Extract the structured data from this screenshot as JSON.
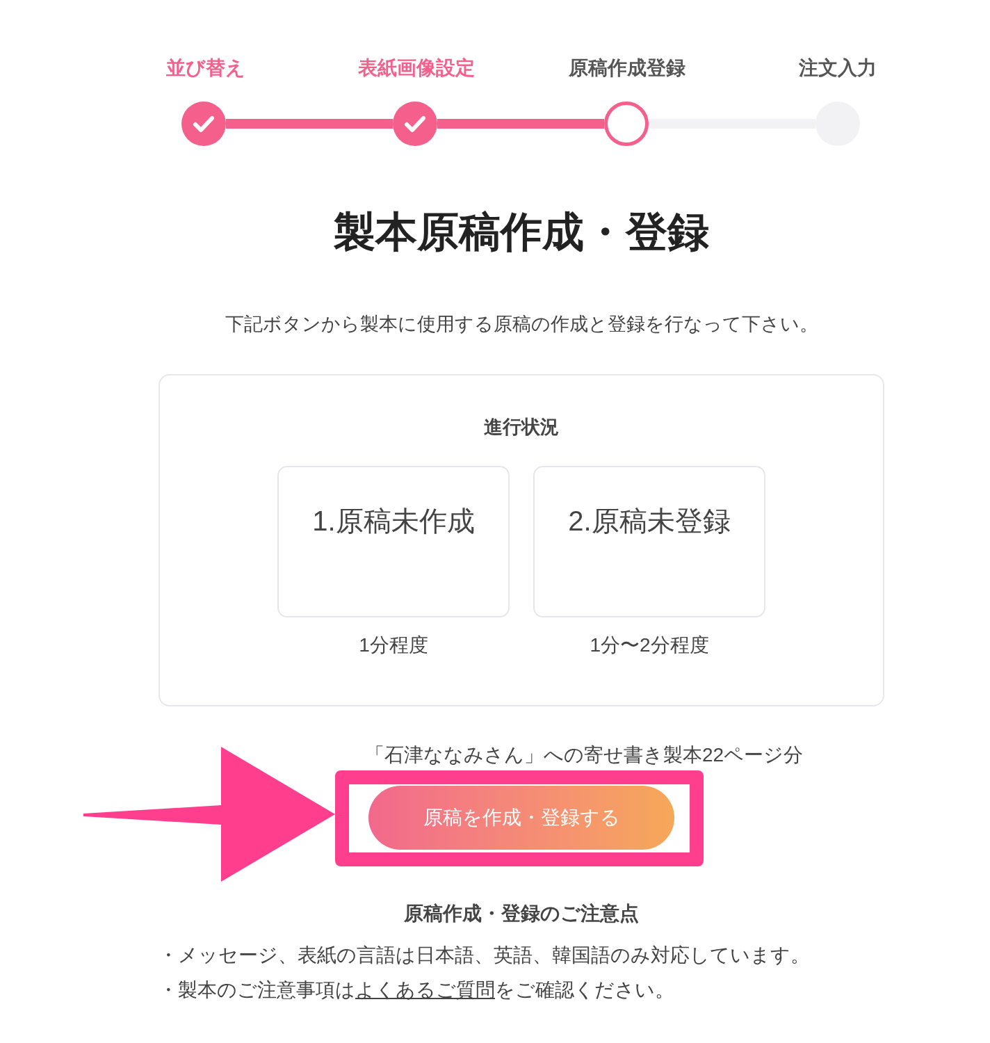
{
  "steps": [
    {
      "label": "並び替え",
      "completed": true,
      "current": false
    },
    {
      "label": "表紙画像設定",
      "completed": true,
      "current": false
    },
    {
      "label": "原稿作成登録",
      "completed": false,
      "current": true
    },
    {
      "label": "注文入力",
      "completed": false,
      "current": false
    }
  ],
  "title": "製本原稿作成・登録",
  "description": "下記ボタンから製本に使用する原稿の作成と登録を行なって下さい。",
  "progress": {
    "title": "進行状況",
    "stages": [
      {
        "label": "1.原稿未作成",
        "duration": "1分程度"
      },
      {
        "label": "2.原稿未登録",
        "duration": "1分〜2分程度"
      }
    ]
  },
  "book_info": "「石津ななみさん」への寄せ書き製本22ページ分",
  "primary_button": "原稿を作成・登録する",
  "callout": {
    "kind": "arrow-and-frame"
  },
  "notes": {
    "title": "原稿作成・登録のご注意点",
    "items": [
      {
        "text": "・メッセージ、表紙の言語は日本語、英語、韓国語のみ対応しています。"
      },
      {
        "text": "・製本のご注意事項は",
        "link": "よくあるご質問",
        "after": "をご確認ください。"
      }
    ]
  }
}
